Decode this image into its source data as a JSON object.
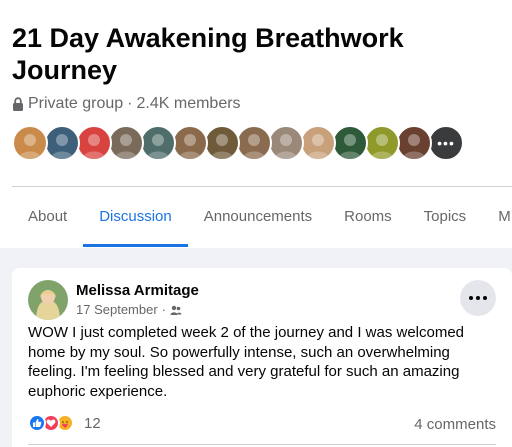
{
  "group": {
    "title": "21 Day Awakening Breathwork Journey",
    "privacy": "Private group",
    "separator": "·",
    "members": "2.4K members"
  },
  "member_avatars": {
    "colors": [
      "#c98a4a",
      "#3d5f7a",
      "#d9433f",
      "#7a6a5a",
      "#4f6d6a",
      "#8a6a4a",
      "#6f5a3a",
      "#8b6b4f",
      "#9a8878",
      "#c8a07a",
      "#2f5a3a",
      "#8f9a2a",
      "#6a4030"
    ],
    "more_label": "•••"
  },
  "tabs": [
    {
      "label": "About",
      "active": false
    },
    {
      "label": "Discussion",
      "active": true
    },
    {
      "label": "Announcements",
      "active": false
    },
    {
      "label": "Rooms",
      "active": false
    },
    {
      "label": "Topics",
      "active": false
    },
    {
      "label": "M",
      "active": false
    }
  ],
  "post": {
    "author": "Melissa Armitage",
    "date": "17 September",
    "separator": "·",
    "text": "WOW I just completed week 2 of the journey and I was welcomed home by my soul.  So powerfully intense, such an overwhelming feeling.  I'm feeling blessed and very grateful for such an amazing euphoric experience.",
    "reaction_count": "12",
    "comments": "4 comments",
    "reactions": [
      "like-icon",
      "love-icon",
      "care-icon"
    ]
  },
  "colors": {
    "accent": "#1b74e4",
    "secondary_text": "#65676b",
    "page_bg": "#f0f2f5"
  }
}
